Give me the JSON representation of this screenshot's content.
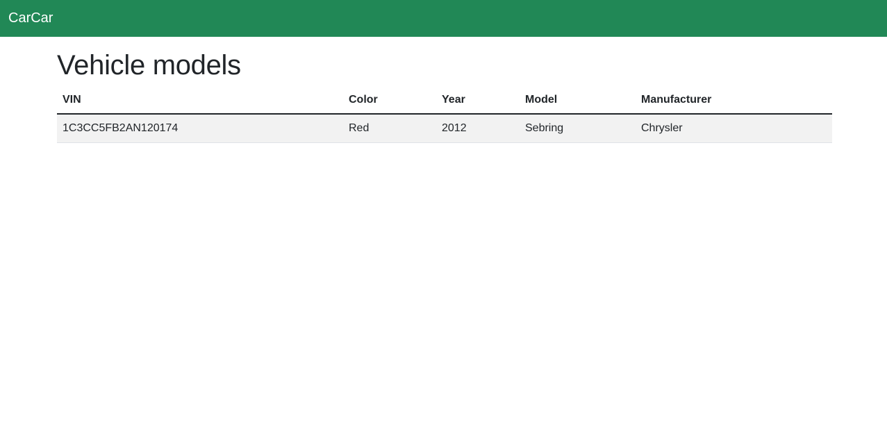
{
  "colors": {
    "navbar_bg": "#218856",
    "brand_text": "#ffffff",
    "stripe_bg": "#f2f2f2"
  },
  "navbar": {
    "brand": "CarCar"
  },
  "page": {
    "title": "Vehicle models"
  },
  "table": {
    "headers": [
      "VIN",
      "Color",
      "Year",
      "Model",
      "Manufacturer"
    ],
    "rows": [
      {
        "vin": "1C3CC5FB2AN120174",
        "color": "Red",
        "year": "2012",
        "model": "Sebring",
        "manufacturer": "Chrysler"
      }
    ]
  }
}
